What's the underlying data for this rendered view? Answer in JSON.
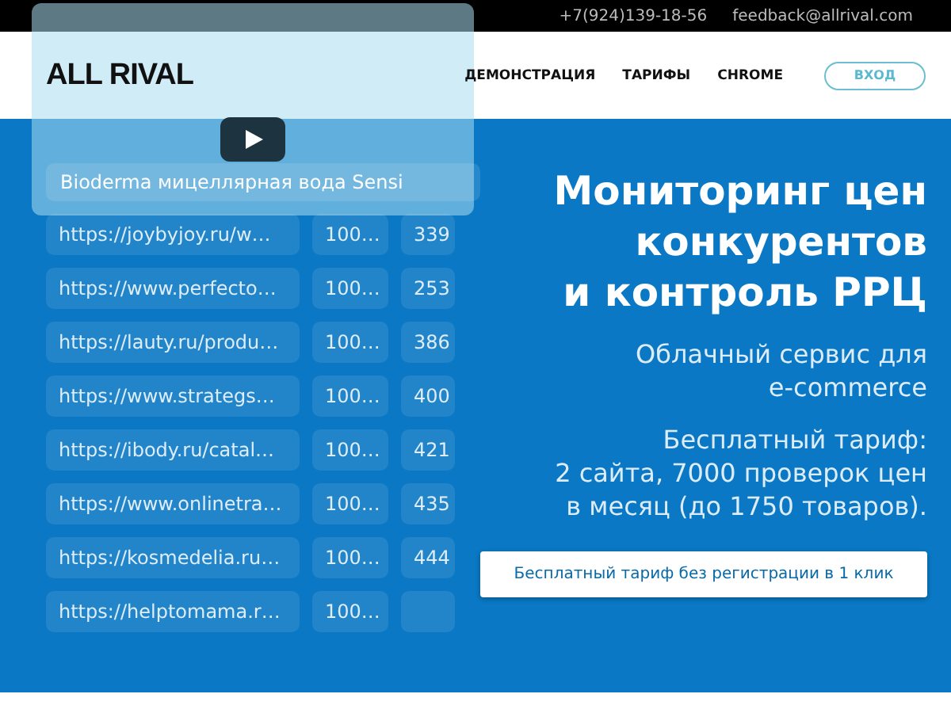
{
  "top_bar": {
    "phone": "+7(924)139-18-56",
    "email": "feedback@allrival.com"
  },
  "header": {
    "logo": "ALL RIVAL",
    "nav": [
      "ДЕМОНСТРАЦИЯ",
      "ТАРИФЫ",
      "CHROME"
    ],
    "login_button": "ВХОД"
  },
  "demo_table": {
    "search_value": "Bioderma мицеллярная вода Sensi",
    "rows": [
      {
        "url": "https://joybyjoy.ru/w…",
        "column_2": "100…",
        "price": "339"
      },
      {
        "url": "https://www.perfecto…",
        "column_2": "100…",
        "price": "253"
      },
      {
        "url": "https://lauty.ru/produ…",
        "column_2": "100…",
        "price": "386"
      },
      {
        "url": "https://www.strategs…",
        "column_2": "100…",
        "price": "400"
      },
      {
        "url": "https://ibody.ru/catal…",
        "column_2": "100…",
        "price": "421"
      },
      {
        "url": "https://www.onlinetra…",
        "column_2": "100…",
        "price": "435"
      },
      {
        "url": "https://kosmedelia.ru…",
        "column_2": "100…",
        "price": "444"
      },
      {
        "url": "https://helptomama.r…",
        "column_2": "100…"
      }
    ]
  },
  "hero": {
    "title_lines": [
      "Мониторинг цен",
      "конкурентов",
      "и контроль РРЦ"
    ],
    "subtitle_lines": [
      "Облачный сервис для",
      "e-commerce"
    ],
    "plan_lines": [
      "Бесплатный тариф:",
      "2 сайта, 7000 проверок цен",
      "в месяц (до 1750 товаров)."
    ],
    "cta_button": "Бесплатный тариф без регистрации в 1 клик"
  }
}
